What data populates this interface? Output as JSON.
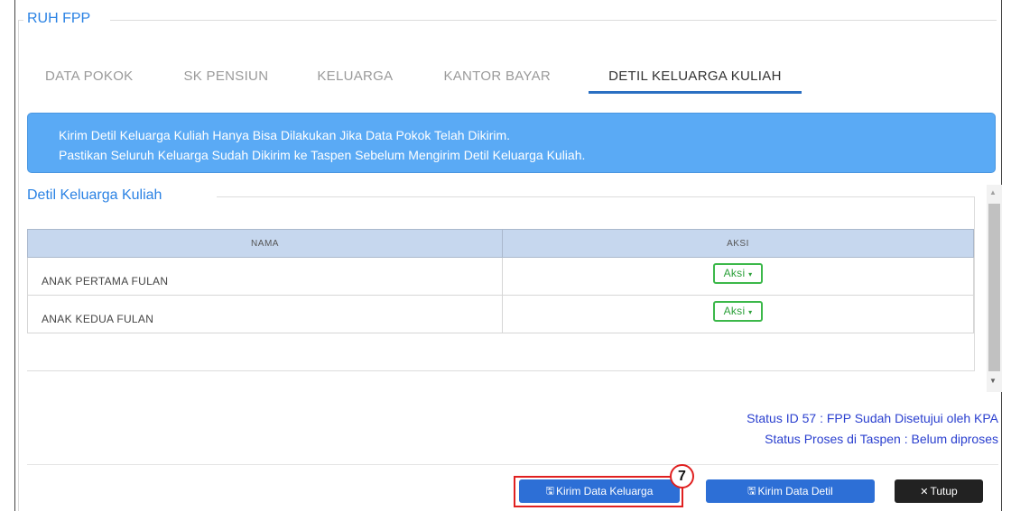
{
  "panel": {
    "legend": "RUH FPP"
  },
  "tabs": [
    {
      "label": "DATA POKOK",
      "active": false
    },
    {
      "label": "SK PENSIUN",
      "active": false
    },
    {
      "label": "KELUARGA",
      "active": false
    },
    {
      "label": "KANTOR BAYAR",
      "active": false
    },
    {
      "label": "DETIL KELUARGA KULIAH",
      "active": true
    }
  ],
  "alert": {
    "line1": "Kirim Detil Keluarga Kuliah Hanya Bisa Dilakukan Jika Data Pokok Telah Dikirim.",
    "line2": "Pastikan Seluruh Keluarga Sudah Dikirim ke Taspen Sebelum Mengirim Detil Keluarga Kuliah."
  },
  "section": {
    "title": "Detil Keluarga Kuliah"
  },
  "table": {
    "columns": [
      "NAMA",
      "AKSI"
    ],
    "rows": [
      {
        "nama": "ANAK PERTAMA FULAN",
        "aksi": "Aksi"
      },
      {
        "nama": "ANAK KEDUA FULAN",
        "aksi": "Aksi"
      }
    ]
  },
  "status": {
    "line1": "Status ID 57 : FPP Sudah Disetujui oleh KPA",
    "line2": "Status Proses di Taspen : Belum diproses"
  },
  "footer": {
    "kirim_keluarga": "Kirim Data Keluarga",
    "kirim_detil": "Kirim Data Detil",
    "tutup": "Tutup"
  },
  "annotation": {
    "step": "7"
  },
  "colors": {
    "accent": "#2a82e4",
    "alert_bg": "#5aaaf5",
    "primary_button": "#2d6fd6",
    "aksi_green": "#3cb84a",
    "status_text": "#2a3fcf",
    "highlight_red": "#e02020"
  },
  "icons": {
    "save": "floppy-disk-icon",
    "close": "times-icon",
    "dropdown": "caret-down-icon"
  }
}
